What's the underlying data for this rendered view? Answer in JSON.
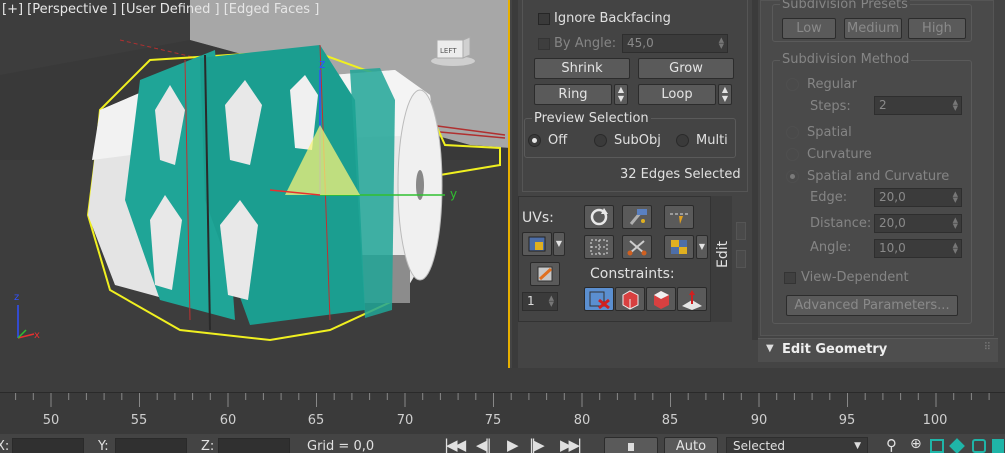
{
  "viewport": {
    "label": "[+] [Perspective ] [User Defined ] [Edged Faces ]",
    "viewcube_label": "LEFT",
    "axis_labels": {
      "z": "z",
      "y": "y",
      "small_z": "z",
      "small_x": "x"
    }
  },
  "selection_panel": {
    "ignore_backfacing": "Ignore Backfacing",
    "by_angle": "By Angle:",
    "by_angle_value": "45,0",
    "shrink": "Shrink",
    "grow": "Grow",
    "ring": "Ring",
    "loop": "Loop",
    "preview_selection": {
      "title": "Preview Selection",
      "options": [
        "Off",
        "SubObj",
        "Multi"
      ],
      "selected": "Off"
    },
    "status": "32 Edges Selected"
  },
  "edit_tools": {
    "uvs_label": "UVs:",
    "constraints_label": "Constraints:",
    "edit_tab": "Edit",
    "uv_spinner_value": "1",
    "icons": [
      "rotate-icon",
      "hammer-icon",
      "cut-lines-icon",
      "grid-select-icon",
      "scissors-icon",
      "map-checker-icon",
      "uv-lock-icon",
      "paint-icon"
    ],
    "constraint_icons": [
      "no-constraint-icon",
      "edge-constraint-icon",
      "face-constraint-icon",
      "normal-constraint-icon"
    ]
  },
  "subdivision": {
    "presets_title": "Subdivision Presets",
    "presets": [
      "Low",
      "Medium",
      "High"
    ],
    "method_title": "Subdivision Method",
    "regular": "Regular",
    "steps_label": "Steps:",
    "steps_value": "2",
    "spatial": "Spatial",
    "curvature": "Curvature",
    "spatial_curvature": "Spatial and Curvature",
    "edge_label": "Edge:",
    "edge_value": "20,0",
    "distance_label": "Distance:",
    "distance_value": "20,0",
    "angle_label": "Angle:",
    "angle_value": "10,0",
    "view_dependent": "View-Dependent",
    "advanced_button": "Advanced Parameters..."
  },
  "edit_geometry_rollout": {
    "title": "Edit Geometry",
    "toggle": "▼"
  },
  "timeline": {
    "ticks": [
      "50",
      "55",
      "60",
      "65",
      "70",
      "75",
      "80",
      "85",
      "90",
      "95",
      "100"
    ]
  },
  "statusbar": {
    "x_label": "X:",
    "y_label": "Y:",
    "z_label": "Z:",
    "grid": "Grid = 0,0",
    "auto": "Auto",
    "selected": "Selected"
  },
  "colors": {
    "accent_selected": "#5b8fd0",
    "teal": "#1fa597",
    "viewport_border": "#e8b000"
  }
}
